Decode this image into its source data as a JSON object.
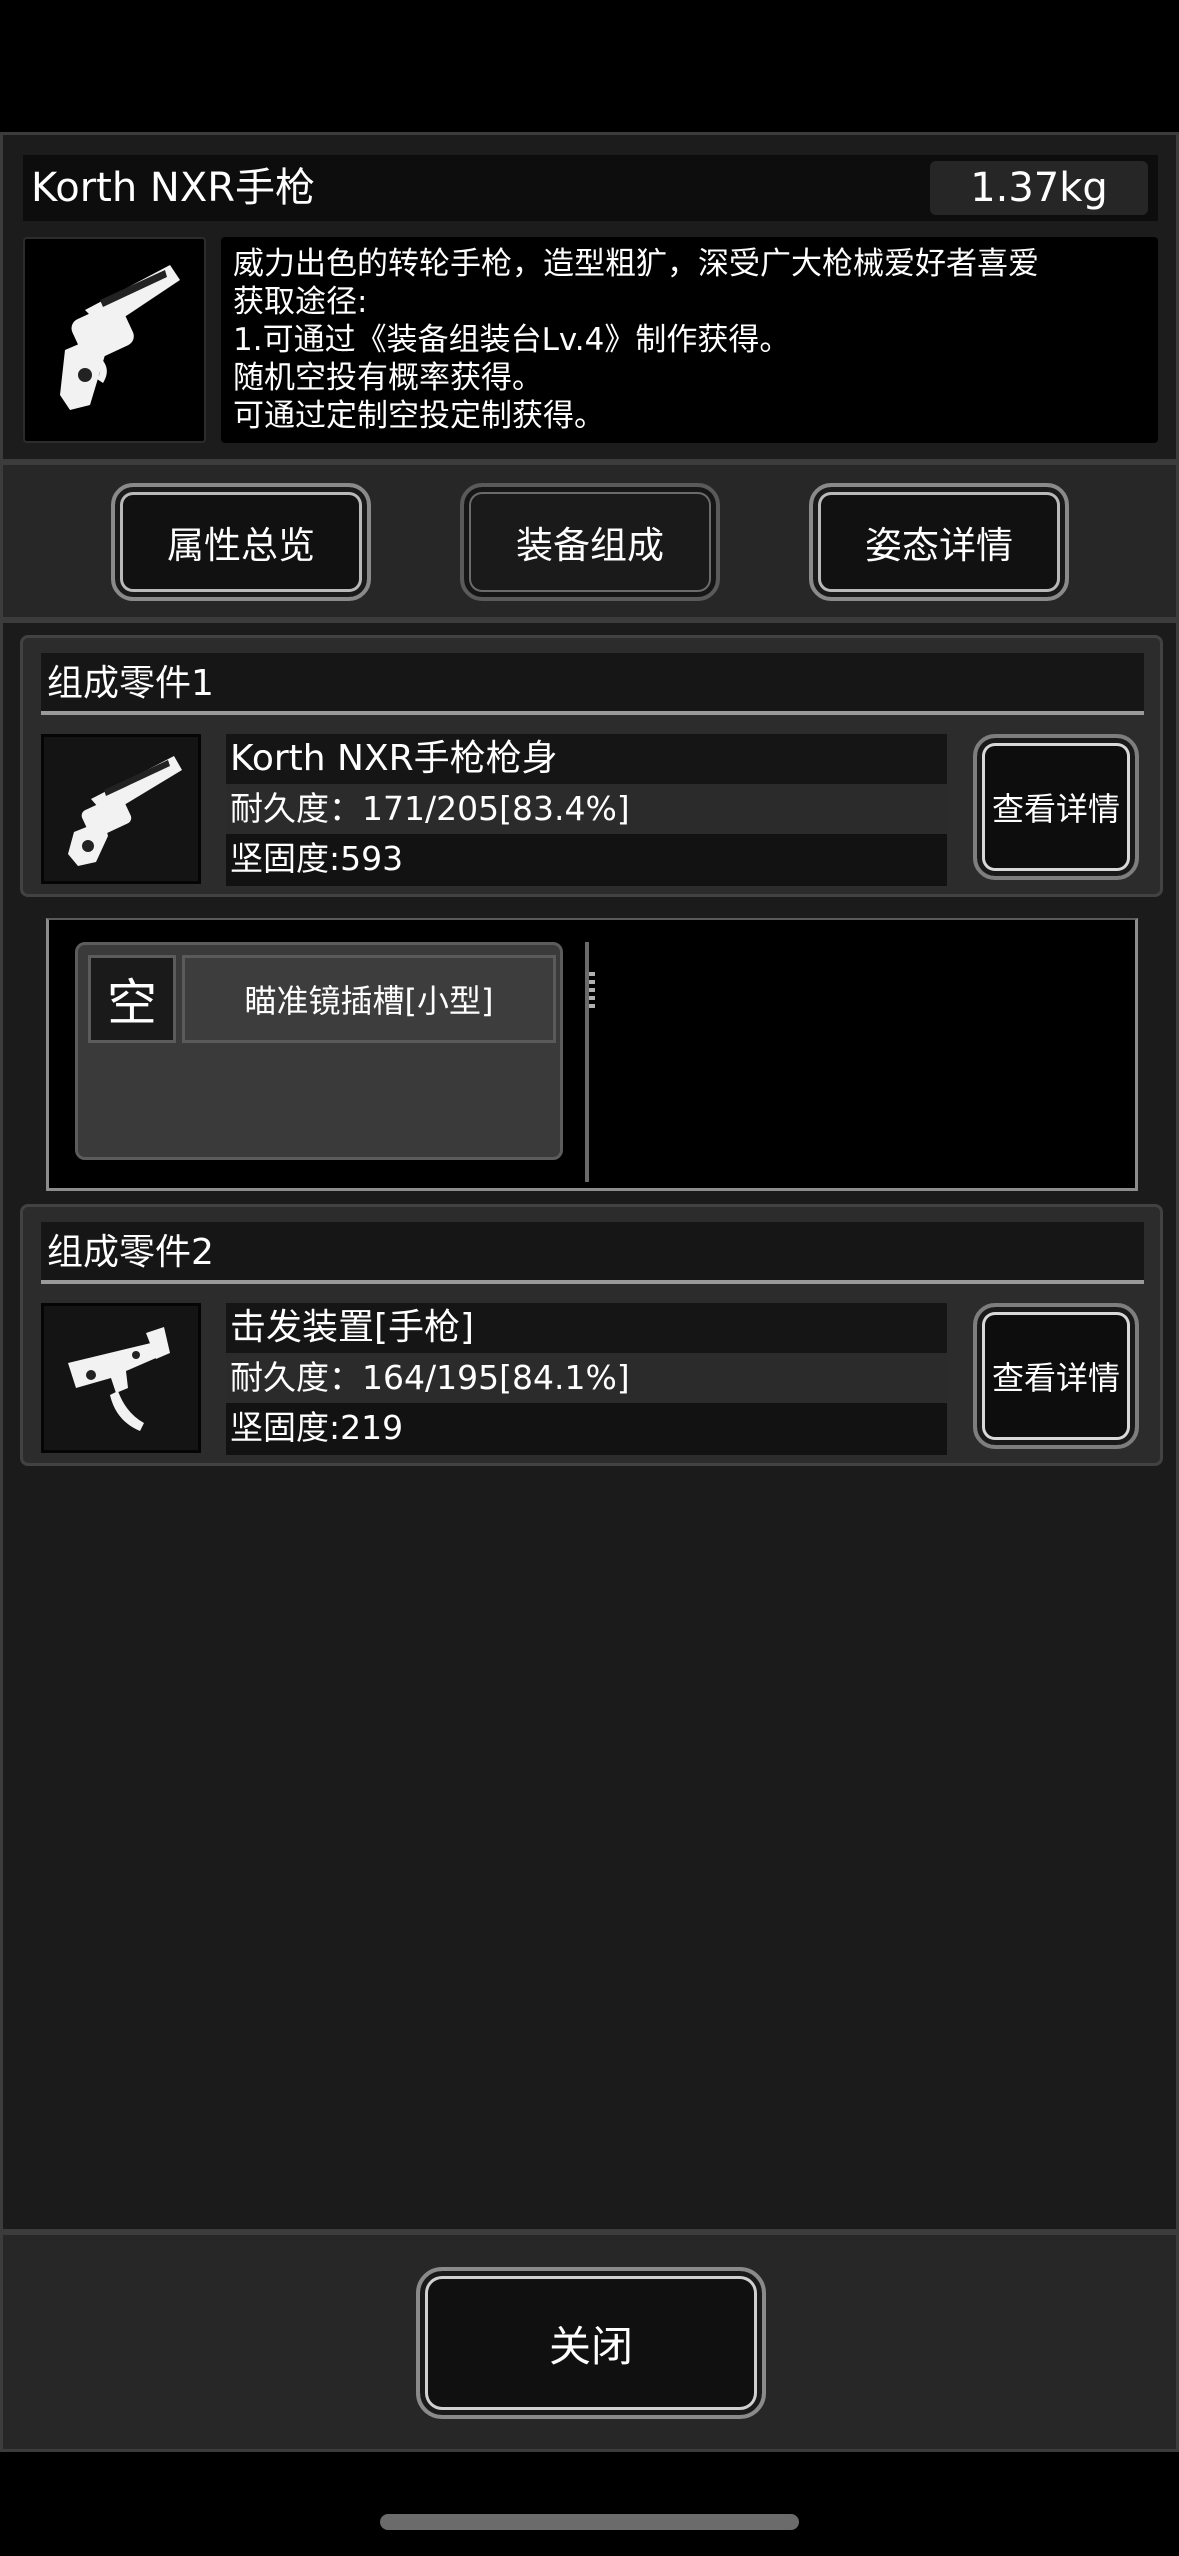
{
  "item": {
    "title": "Korth NXR手枪",
    "weight": "1.37kg",
    "icon": "revolver-icon",
    "description": [
      "威力出色的转轮手枪，造型粗犷，深受广大枪械爱好者喜爱",
      "获取途径:",
      "1.可通过《装备组装台Lv.4》制作获得。",
      "随机空投有概率获得。",
      "可通过定制空投定制获得。"
    ]
  },
  "tabs": [
    {
      "label": "属性总览",
      "active": false
    },
    {
      "label": "装备组成",
      "active": true
    },
    {
      "label": "姿态详情",
      "active": false
    }
  ],
  "parts": [
    {
      "header": "组成零件1",
      "icon": "revolver-frame-icon",
      "name": "Korth NXR手枪枪身",
      "durability": "耐久度：171/205[83.4%]",
      "hardness": "坚固度:593",
      "detail_label": "查看详情"
    },
    {
      "header": "组成零件2",
      "icon": "trigger-mechanism-icon",
      "name": "击发装置[手枪]",
      "durability": "耐久度：164/195[84.1%]",
      "hardness": "坚固度:219",
      "detail_label": "查看详情"
    }
  ],
  "slots": [
    {
      "state": "空",
      "label": "瞄准镜插槽[小型]"
    }
  ],
  "footer": {
    "close_label": "关闭"
  },
  "colors": {
    "background": "#1c1c1c",
    "border": "#3c3c3c",
    "text": "#ffffff"
  }
}
